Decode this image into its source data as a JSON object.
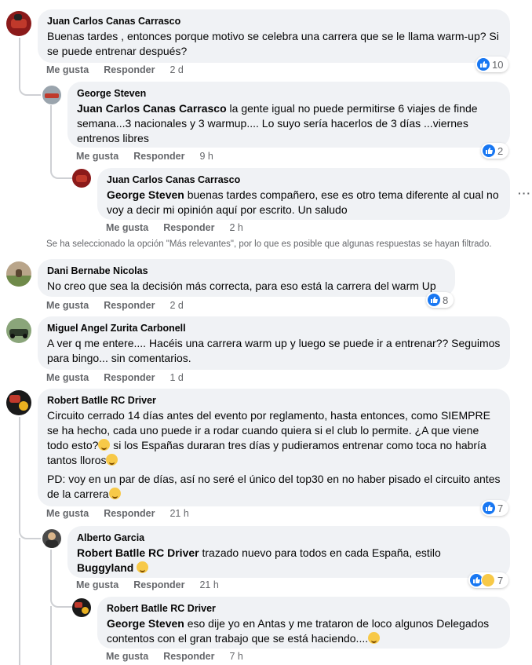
{
  "actions": {
    "like": "Me gusta",
    "reply": "Responder"
  },
  "notice": "Se ha seleccionado la opción \"Más relevantes\", por lo que es posible que algunas respuestas se hayan filtrado.",
  "comments": [
    {
      "author": "Juan Carlos Canas Carrasco",
      "text": "Buenas tardes , entonces porque motivo se celebra una carrera que se le llama warm-up? Si se puede entrenar después?",
      "time": "2 d",
      "reactions": "10"
    },
    {
      "author": "George Steven",
      "mention": "Juan Carlos Canas Carrasco",
      "text": " la gente igual no puede permitirse 6 viajes de finde semana...3 nacionales y 3 warmup.... Lo suyo sería hacerlos de 3 días ...viernes entrenos libres",
      "time": "9 h",
      "reactions": "2"
    },
    {
      "author": "Juan Carlos Canas Carrasco",
      "mention": "George Steven",
      "text": " buenas tardes compañero, ese es otro tema diferente al cual no voy a decir mi opinión aquí por escrito. Un saludo",
      "time": "2 h"
    },
    {
      "author": "Dani Bernabe Nicolas",
      "text": "No creo que sea la decisión más correcta, para eso está la carrera del warm Up",
      "time": "2 d",
      "reactions": "8"
    },
    {
      "author": "Miguel Angel Zurita Carbonell",
      "text": "A ver q me entere.... Hacéis una carrera warm up y luego se puede ir a entrenar?? Seguimos para bingo... sin comentarios.",
      "time": "1 d"
    },
    {
      "author": "Robert Batlle RC Driver",
      "text": "Circuito cerrado 14 días antes del evento por reglamento, hasta entonces, como SIEMPRE se ha hecho, cada uno puede ir a rodar cuando quiera si el club lo permite. ¿A que viene todo esto?",
      "text_b": " si los Españas duraran tres días y pudieramos entrenar como toca no habría tantos lloros",
      "text2": "PD: voy en un par de días, así no seré el único del top30 en no haber pisado el circuito antes de la carrera",
      "time": "21 h",
      "reactions": "7"
    },
    {
      "author": "Alberto Garcia",
      "mention": "Robert Batlle RC Driver",
      "text": " trazado nuevo para todos en cada España, estilo ",
      "mention2": "Buggyland",
      "time": "21 h",
      "reactions": "7"
    },
    {
      "author": "Robert Batlle RC Driver",
      "mention": "George Steven",
      "text": " eso dije yo en Antas y me trataron de loco algunos Delegados contentos con el gran trabajo que se está haciendo....",
      "time": "7 h"
    }
  ]
}
